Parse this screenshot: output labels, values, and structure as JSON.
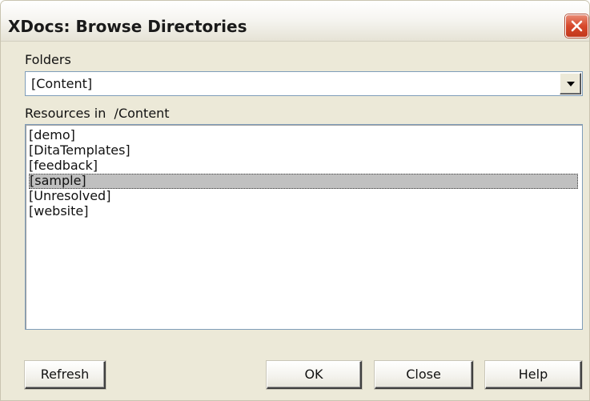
{
  "window": {
    "title": "XDocs: Browse Directories",
    "close_icon": "close-x-icon",
    "close_color": "#d7482b"
  },
  "folders": {
    "label": "Folders",
    "selected": "[Content]",
    "dropdown_icon": "chevron-down-icon"
  },
  "resources": {
    "label": "Resources in  /Content",
    "items": [
      {
        "label": "[demo]",
        "selected": false
      },
      {
        "label": "[DitaTemplates]",
        "selected": false
      },
      {
        "label": "[feedback]",
        "selected": false
      },
      {
        "label": "[sample]",
        "selected": true
      },
      {
        "label": "[Unresolved]",
        "selected": false
      },
      {
        "label": "[website]",
        "selected": false
      }
    ]
  },
  "buttons": {
    "refresh": "Refresh",
    "ok": "OK",
    "close": "Close",
    "help": "Help"
  }
}
